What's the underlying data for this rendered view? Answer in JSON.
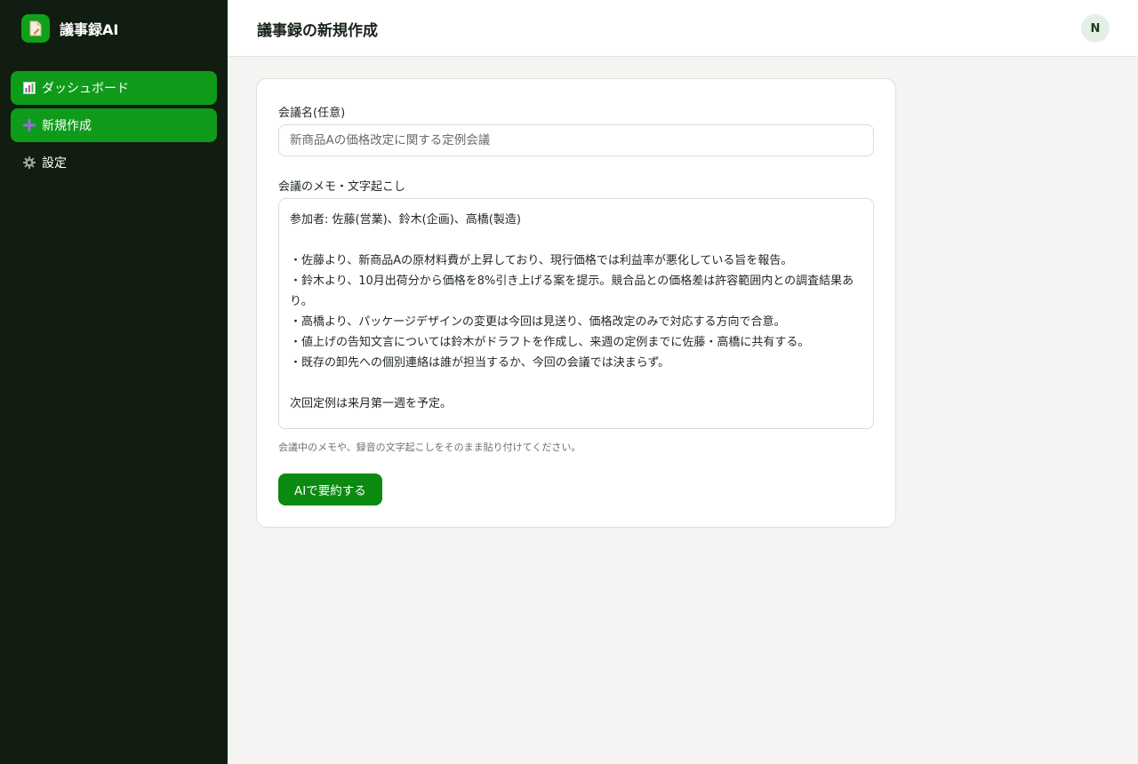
{
  "app": {
    "name": "議事録AI",
    "logo_icon": "document-icon"
  },
  "sidebar": {
    "items": [
      {
        "label": "ダッシュボード",
        "icon": "bar-chart-icon"
      },
      {
        "label": "新規作成",
        "icon": "plus-icon"
      },
      {
        "label": "設定",
        "icon": "gear-icon"
      }
    ]
  },
  "header": {
    "title": "議事録の新規作成",
    "avatar_initial": "N"
  },
  "form": {
    "meeting_name_label": "会議名(任意)",
    "meeting_name_placeholder": "新商品Aの価格改定に関する定例会議",
    "memo_label": "会議のメモ・文字起こし",
    "memo_value": "参加者: 佐藤(営業)、鈴木(企画)、高橋(製造)\n\n・佐藤より、新商品Aの原材料費が上昇しており、現行価格では利益率が悪化している旨を報告。\n・鈴木より、10月出荷分から価格を8%引き上げる案を提示。競合品との価格差は許容範囲内との調査結果あり。\n・高橋より、パッケージデザインの変更は今回は見送り、価格改定のみで対応する方向で合意。\n・値上げの告知文言については鈴木がドラフトを作成し、来週の定例までに佐藤・高橋に共有する。\n・既存の卸先への個別連絡は誰が担当するか、今回の会議では決まらず。\n\n次回定例は来月第一週を予定。",
    "hint": "会議中のメモや、録音の文字起こしをそのまま貼り付けてください。",
    "submit_label": "AIで要約する"
  },
  "colors": {
    "sidebar_bg": "#111d11",
    "accent": "#0f9b1a",
    "button": "#0a8a10"
  }
}
